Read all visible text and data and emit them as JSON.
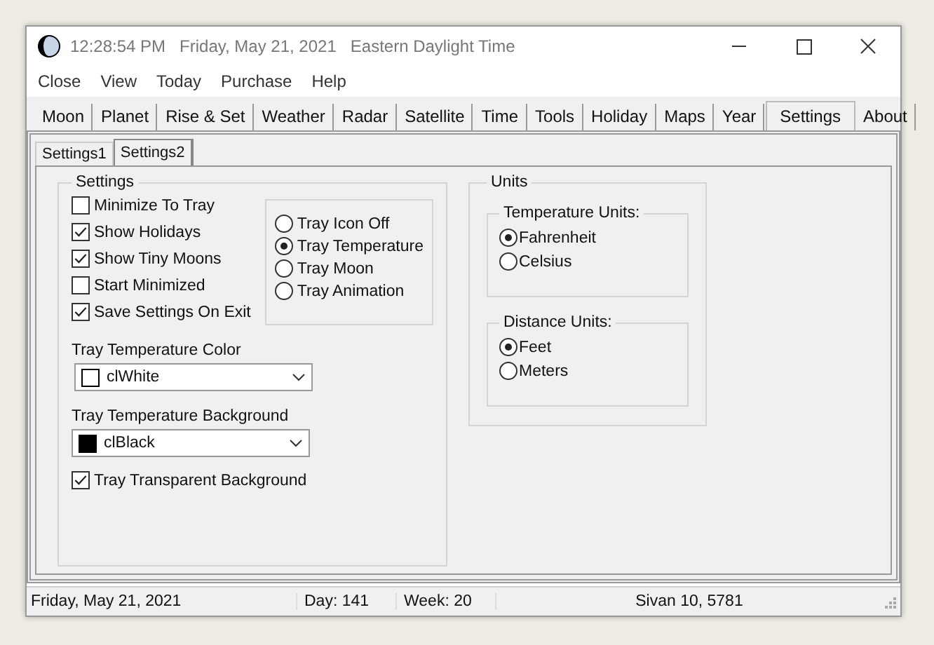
{
  "window": {
    "time": "12:28:54  PM",
    "date": "Friday, May 21, 2021",
    "zone": "Eastern Daylight Time"
  },
  "menu": [
    "Close",
    "View",
    "Today",
    "Purchase",
    "Help"
  ],
  "tabs": [
    {
      "label": "Moon",
      "selected": false
    },
    {
      "label": "Planet",
      "selected": false
    },
    {
      "label": "Rise & Set",
      "selected": false
    },
    {
      "label": "Weather",
      "selected": false
    },
    {
      "label": "Radar",
      "selected": false
    },
    {
      "label": "Satellite",
      "selected": false
    },
    {
      "label": "Time",
      "selected": false
    },
    {
      "label": "Tools",
      "selected": false
    },
    {
      "label": "Holiday",
      "selected": false
    },
    {
      "label": "Maps",
      "selected": false
    },
    {
      "label": "Year",
      "selected": false
    },
    {
      "label": "Settings",
      "selected": true
    },
    {
      "label": "About",
      "selected": false
    }
  ],
  "subtabs": [
    {
      "label": "Settings1",
      "selected": false
    },
    {
      "label": "Settings2",
      "selected": true
    }
  ],
  "settings": {
    "title": "Settings",
    "checks": [
      {
        "label": "Minimize To Tray",
        "checked": false
      },
      {
        "label": "Show Holidays",
        "checked": true
      },
      {
        "label": "Show Tiny Moons",
        "checked": true
      },
      {
        "label": "Start Minimized",
        "checked": false
      },
      {
        "label": "Save Settings On Exit",
        "checked": true
      }
    ],
    "tray_options": [
      {
        "label": "Tray Icon Off",
        "selected": false
      },
      {
        "label": "Tray Temperature",
        "selected": true
      },
      {
        "label": "Tray Moon",
        "selected": false
      },
      {
        "label": "Tray Animation",
        "selected": false
      }
    ],
    "color_fields": [
      {
        "label": "Tray Temperature Color",
        "value": "clWhite",
        "color": "#ffffff"
      },
      {
        "label": "Tray Temperature Background",
        "value": "clBlack",
        "color": "#000000"
      }
    ],
    "transparent": {
      "label": "Tray Transparent Background",
      "checked": true
    }
  },
  "units": {
    "title": "Units",
    "groups": [
      {
        "title": "Temperature Units:",
        "options": [
          {
            "label": "Fahrenheit",
            "selected": true
          },
          {
            "label": "Celsius",
            "selected": false
          }
        ]
      },
      {
        "title": "Distance Units:",
        "options": [
          {
            "label": "Feet",
            "selected": true
          },
          {
            "label": "Meters",
            "selected": false
          }
        ]
      }
    ]
  },
  "status_bar": [
    "Friday, May 21, 2021",
    "Day: 141",
    "Week: 20",
    "Sivan 10, 5781"
  ]
}
